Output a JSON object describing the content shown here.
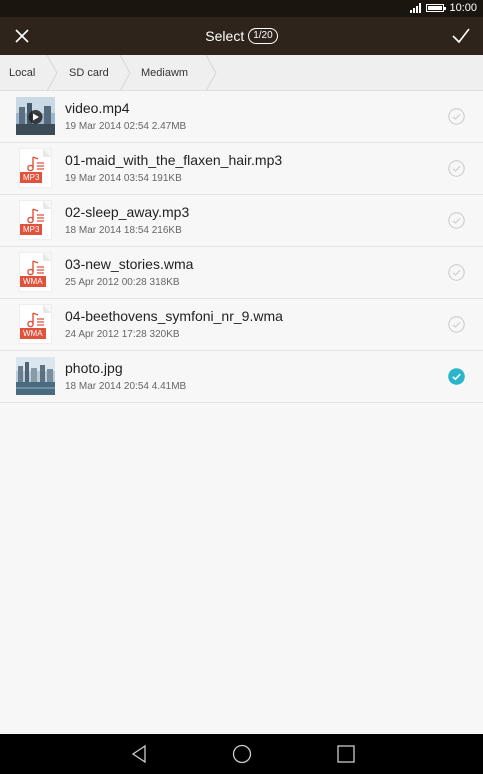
{
  "status_bar": {
    "time": "10:00"
  },
  "title_bar": {
    "title": "Select",
    "count": "1/20"
  },
  "breadcrumb": [
    "Local",
    "SD card",
    "Mediawm"
  ],
  "files": [
    {
      "name": "video.mp4",
      "meta": "19 Mar 2014 02:54 2.47MB",
      "type": "video",
      "selected": false
    },
    {
      "name": "01-maid_with_the_flaxen_hair.mp3",
      "meta": "19 Mar 2014 03:54 191KB",
      "type": "audio",
      "tag": "MP3",
      "selected": false
    },
    {
      "name": "02-sleep_away.mp3",
      "meta": "18 Mar 2014 18:54 216KB",
      "type": "audio",
      "tag": "MP3",
      "selected": false
    },
    {
      "name": "03-new_stories.wma",
      "meta": "25 Apr 2012 00:28 318KB",
      "type": "audio",
      "tag": "WMA",
      "selected": false
    },
    {
      "name": "04-beethovens_symfoni_nr_9.wma",
      "meta": "24 Apr 2012 17:28 320KB",
      "type": "audio",
      "tag": "WMA",
      "selected": false
    },
    {
      "name": "photo.jpg",
      "meta": "18 Mar 2014 20:54 4.41MB",
      "type": "image",
      "selected": true
    }
  ],
  "colors": {
    "accent": "#2bb5c9",
    "title_bar": "#2e241c",
    "status_bar": "#1b1510",
    "audio_tag": "#e0523b"
  }
}
